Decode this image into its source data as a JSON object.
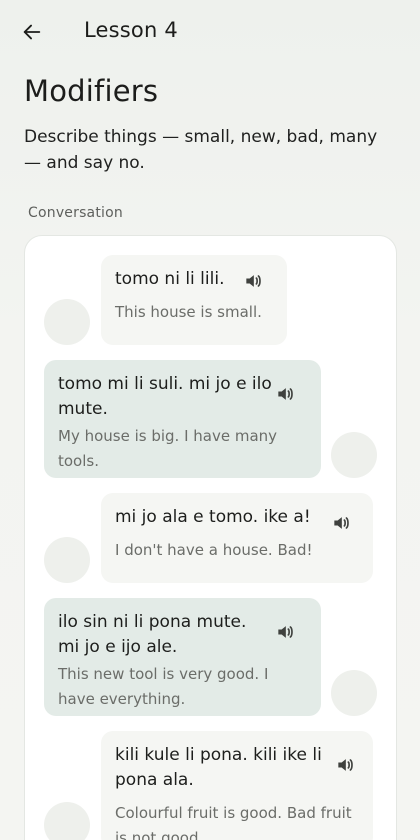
{
  "header": {
    "title": "Lesson 4"
  },
  "page": {
    "title": "Modifiers",
    "description": "Describe things — small, new, bad, many — and say no.",
    "section_label": "Conversation"
  },
  "conversation": [
    {
      "side": "right",
      "toki_pona": "tomo ni li lili.",
      "english": "This house is small."
    },
    {
      "side": "left",
      "toki_pona": "tomo mi li suli. mi jo e ilo mute.",
      "english": "My house is big. I have many tools."
    },
    {
      "side": "right",
      "toki_pona": "mi jo ala e tomo. ike a!",
      "english": "I don't have a house. Bad!"
    },
    {
      "side": "left",
      "toki_pona": "ilo sin ni li pona mute. mi jo e ijo ale.",
      "english": "This new tool is very good. I have everything."
    },
    {
      "side": "right",
      "toki_pona": "kili kule li pona. kili ike li pona ala.",
      "english": "Colourful fruit is good. Bad fruit is not good."
    }
  ],
  "icons": {
    "back": "arrow-left-icon",
    "audio": "speaker-icon"
  }
}
